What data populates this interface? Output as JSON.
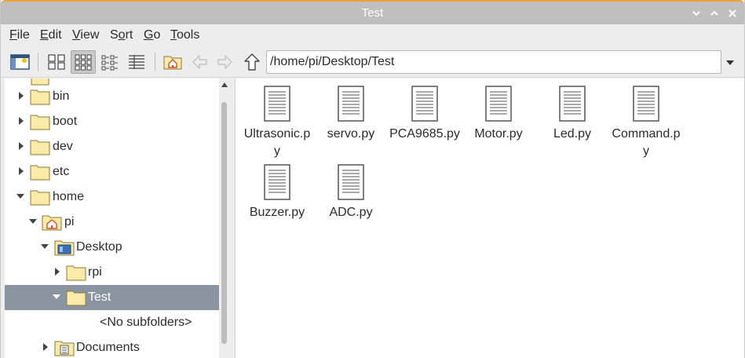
{
  "window": {
    "title": "Test"
  },
  "menubar": {
    "items": [
      {
        "label": "File",
        "accel": "F",
        "rest": "ile"
      },
      {
        "label": "Edit",
        "accel": "E",
        "rest": "dit"
      },
      {
        "label": "View",
        "accel": "V",
        "rest": "iew"
      },
      {
        "label": "Sort",
        "accel": "o",
        "pre": "S",
        "rest": "rt"
      },
      {
        "label": "Go",
        "accel": "G",
        "rest": "o"
      },
      {
        "label": "Tools",
        "accel": "T",
        "rest": "ools"
      }
    ]
  },
  "toolbar": {
    "path": "/home/pi/Desktop/Test",
    "view_mode_active": "icon-view"
  },
  "tree": {
    "items": [
      {
        "label": "bin",
        "expander": "collapsed",
        "icon": "folder-icon",
        "level": 1
      },
      {
        "label": "boot",
        "expander": "collapsed",
        "icon": "folder-icon",
        "level": 1
      },
      {
        "label": "dev",
        "expander": "collapsed",
        "icon": "folder-icon",
        "level": 1
      },
      {
        "label": "etc",
        "expander": "collapsed",
        "icon": "folder-icon",
        "level": 1
      },
      {
        "label": "home",
        "expander": "expanded",
        "icon": "folder-icon",
        "level": 1
      },
      {
        "label": "pi",
        "expander": "expanded",
        "icon": "home-folder-icon",
        "level": 2
      },
      {
        "label": "Desktop",
        "expander": "expanded",
        "icon": "desktop-folder-icon",
        "level": 3
      },
      {
        "label": "rpi",
        "expander": "collapsed",
        "icon": "folder-icon",
        "level": 4
      },
      {
        "label": "Test",
        "expander": "expanded",
        "icon": "folder-icon",
        "level": 4,
        "selected": true
      },
      {
        "label": "<No subfolders>",
        "expander": "none",
        "icon": "",
        "level": 5
      },
      {
        "label": "Documents",
        "expander": "collapsed",
        "icon": "documents-folder-icon",
        "level": 3
      }
    ]
  },
  "files": {
    "row1": [
      {
        "name_line1": "Ultrasonic.p",
        "name_line2": "y"
      },
      {
        "name_line1": "servo.py",
        "name_line2": ""
      },
      {
        "name_line1": "PCA9685.py",
        "name_line2": ""
      },
      {
        "name_line1": "Motor.py",
        "name_line2": ""
      },
      {
        "name_line1": "Led.py",
        "name_line2": ""
      },
      {
        "name_line1": "Command.p",
        "name_line2": "y"
      }
    ],
    "row2": [
      {
        "name_line1": "Buzzer.py",
        "name_line2": ""
      },
      {
        "name_line1": "ADC.py",
        "name_line2": ""
      }
    ]
  },
  "colors": {
    "titlebar": "#bfbfbf",
    "titlebar_accent": "#f0a035",
    "selection": "#8b95a1",
    "folder_fill": "#fbeaa8"
  }
}
